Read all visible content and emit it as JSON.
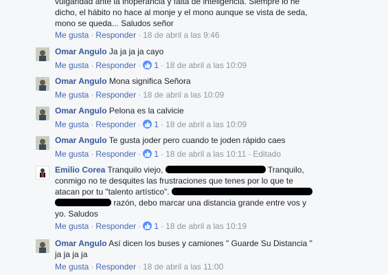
{
  "first": {
    "lines": [
      "vulgaridad ante la inoperancia y falta de inteligencia. Siempre lo he",
      "dicho, el hábito no hace al monje y el mono aunque se vista de seda,",
      "mono se queda... Saludos señor"
    ],
    "actions": {
      "like": "Me gusta",
      "reply": "Responder",
      "time": "18 de abril a las 9:46"
    }
  },
  "comments": [
    {
      "author": "Omar Angulo",
      "text": "Ja ja ja ja cayo",
      "like": "Me gusta",
      "reply": "Responder",
      "reactions": "1",
      "time": "18 de abril a las 10:09"
    },
    {
      "author": "Omar Angulo",
      "text": "Mona significa Señora",
      "like": "Me gusta",
      "reply": "Responder",
      "time": "18 de abril a las 10:09"
    },
    {
      "author": "Omar Angulo",
      "text": "Pelona es la calvicie",
      "like": "Me gusta",
      "reply": "Responder",
      "reactions": "1",
      "time": "18 de abril a las 10:09"
    },
    {
      "author": "Omar Angulo",
      "text": "Te gusta joder pero cuando te joden rápido caes",
      "like": "Me gusta",
      "reply": "Responder",
      "reactions": "1",
      "time": "18 de abril a las 10:11",
      "edited": "Editado"
    },
    {
      "author": "Emilio Corea",
      "text1a": "Tranquilo viejo,",
      "text1b": "Tranquilo,",
      "text2": "conmigo no te desquites las frustraciones que tenes por lo que te",
      "text3a": "atacan por tu \"talento artístico\".",
      "text4b": "razón, debo marcar una distancia grande entre vos y",
      "text5": "yo. Saludos",
      "like": "Me gusta",
      "reply": "Responder",
      "reactions": "1",
      "time": "18 de abril a las 10:19"
    },
    {
      "author": "Omar Angulo",
      "text": "Así dicen los buses y camiones \" Guarde Su Distancia \"",
      "text2": "ja ja ja ja",
      "like": "Me gusta",
      "reply": "Responder",
      "time": "18 de abril a las 11:00"
    }
  ],
  "colors": {
    "author": "#365899",
    "link": "#4267b2",
    "meta": "#90949c",
    "like_badge": "#5890ff"
  }
}
